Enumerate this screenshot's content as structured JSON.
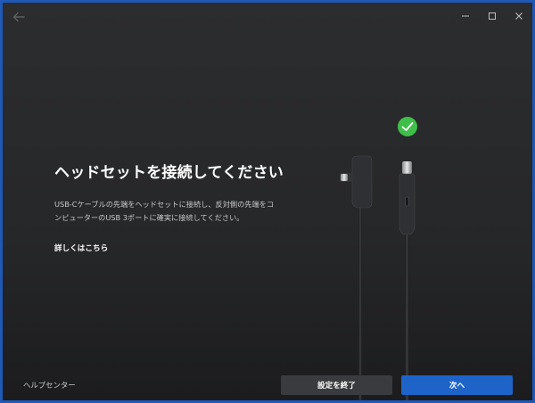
{
  "window": {
    "controls": {
      "minimize_icon": "minimize-icon",
      "maximize_icon": "maximize-icon",
      "close_icon": "close-icon"
    }
  },
  "main": {
    "title": "ヘッドセットを接続してください",
    "description": "USB-Cケーブルの先端をヘッドセットに接続し、反対側の先端をコンピューターのUSB 3ポートに確実に接続してください。",
    "learn_more": "詳しくはこちら"
  },
  "illustration": {
    "status_icon": "checkmark-icon",
    "status_color": "#3fbf4a"
  },
  "footer": {
    "help_link": "ヘルプセンター",
    "end_setup_label": "設定を終了",
    "next_label": "次へ"
  },
  "colors": {
    "accent": "#1e64c8",
    "success": "#3fbf4a"
  }
}
